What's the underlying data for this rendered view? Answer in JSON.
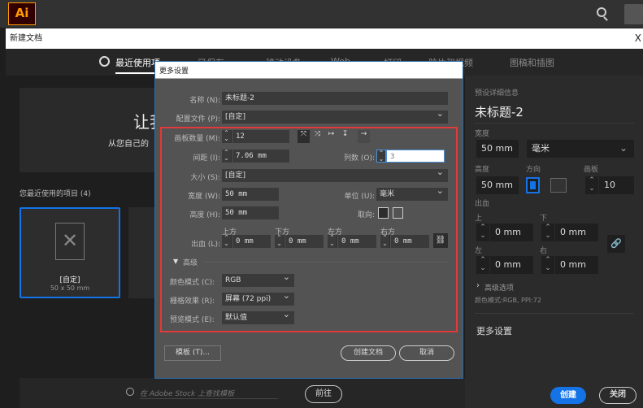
{
  "app": {
    "logo": "Ai",
    "search_icon": "search-icon"
  },
  "window": {
    "title": "新建文档",
    "close": "X"
  },
  "tabs": [
    {
      "label": "最近使用项",
      "active": true
    },
    {
      "label": "已保存"
    },
    {
      "label": "移动设备"
    },
    {
      "label": "Web"
    },
    {
      "label": "打印"
    },
    {
      "label": "胶片和视频"
    },
    {
      "label": "图稿和插图"
    }
  ],
  "hero": {
    "title": "让我",
    "subtitle": "从您自己的"
  },
  "recent": {
    "label": "您最近使用的项目 (4)",
    "items": [
      {
        "name": "[自定]",
        "size": "50 x 50 mm"
      }
    ]
  },
  "stock": {
    "placeholder": "在 Adobe Stock 上查找模板",
    "go": "前往"
  },
  "dialog": {
    "title": "更多设置",
    "name_label": "名称 (N):",
    "name": "未标题-2",
    "profile_label": "配置文件 (P):",
    "profile": "[自定]",
    "artboards_label": "画板数量 (M):",
    "artboards": "12",
    "spacing_label": "间距 (I):",
    "spacing": "7.06 mm",
    "columns_label": "列数 (O):",
    "columns": "3",
    "size_label": "大小 (S):",
    "size": "[自定]",
    "width_label": "宽度 (W):",
    "width": "50 mm",
    "units_label": "单位 (U):",
    "units": "毫米",
    "height_label": "高度 (H):",
    "height": "50 mm",
    "orient_label": "取向:",
    "bleed_label": "出血 (L):",
    "bleed": [
      {
        "label": "上方",
        "value": "0 mm"
      },
      {
        "label": "下方",
        "value": "0 mm"
      },
      {
        "label": "左方",
        "value": "0 mm"
      },
      {
        "label": "右方",
        "value": "0 mm"
      }
    ],
    "advanced": "高级",
    "color_label": "颜色模式 (C):",
    "color": "RGB",
    "raster_label": "栅格效果 (R):",
    "raster": "屏幕 (72 ppi)",
    "preview_label": "预览模式 (E):",
    "preview": "默认值",
    "templates": "模板 (T)...",
    "create": "创建文档",
    "cancel": "取消",
    "highlight_color": "#e03a3a"
  },
  "preset": {
    "header": "预设详细信息",
    "title": "未标题-2",
    "width_label": "宽度",
    "width": "50 mm",
    "units": "毫米",
    "height_label": "高度",
    "height": "50 mm",
    "orient_label": "方向",
    "artboards_label": "画板",
    "artboards": "10",
    "bleed_label": "出血",
    "bleed": [
      {
        "label": "上",
        "value": "0 mm"
      },
      {
        "label": "下",
        "value": "0 mm"
      },
      {
        "label": "左",
        "value": "0 mm"
      },
      {
        "label": "右",
        "value": "0 mm"
      }
    ],
    "advanced": "高级选项",
    "summary": "颜色模式:RGB, PPI:72",
    "more": "更多设置"
  },
  "footer": {
    "create": "创建",
    "close": "关闭"
  },
  "accent": "#1473e6"
}
